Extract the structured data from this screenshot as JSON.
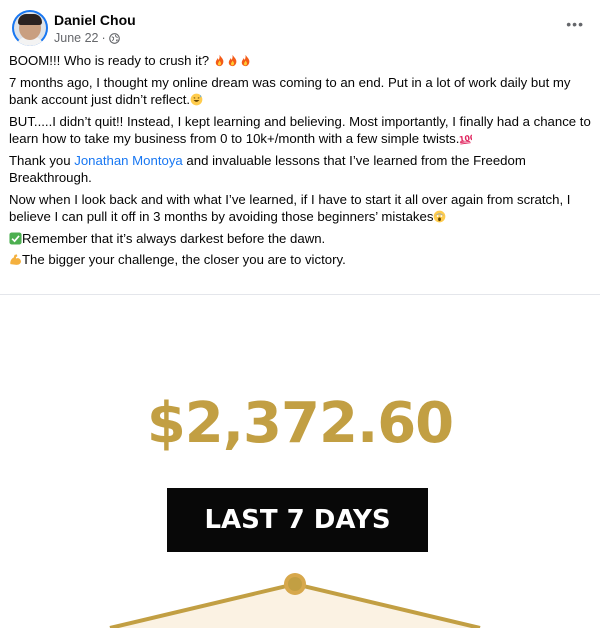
{
  "post": {
    "author": "Daniel Chou",
    "date": "June 22",
    "separator": "·",
    "more": "•••",
    "paragraphs": {
      "p1": "BOOM!!! Who is ready to crush it?",
      "p2": "7 months ago, I thought my online dream was coming to an end. Put in a lot of work daily but my bank account just didn’t reflect.",
      "p3": "BUT.....I didn’t quit!! Instead, I kept learning and believing. Most importantly, I finally had a chance to learn how to take my business from 0 to 10k+/month with a few simple twists.",
      "p4_before": "Thank you ",
      "p4_link": "Jonathan Montoya",
      "p4_after": " and invaluable lessons that I’ve learned from the Freedom Breakthrough.",
      "p5": "Now when I look back and with what I’ve learned, if I have to start it all over again from scratch, I believe I can pull it off in 3 months by avoiding those beginners’ mistakes",
      "p6": "Remember that it’s always darkest before the dawn.",
      "p7": "The bigger your challenge, the closer you are to victory."
    },
    "icons": {
      "fire": "fire-emoji",
      "grin": "grinning-sweat-emoji",
      "hundred": "hundred-points-emoji",
      "scream": "face-screaming-emoji",
      "check": "check-mark-emoji",
      "muscle": "flexed-biceps-emoji",
      "privacy": "globe-icon"
    }
  },
  "image": {
    "amount": "$2,372.60",
    "badge": "LAST 7 DAYS"
  },
  "colors": {
    "gold": "#c29f43",
    "link": "#1877f2",
    "badge_bg": "#080808"
  }
}
